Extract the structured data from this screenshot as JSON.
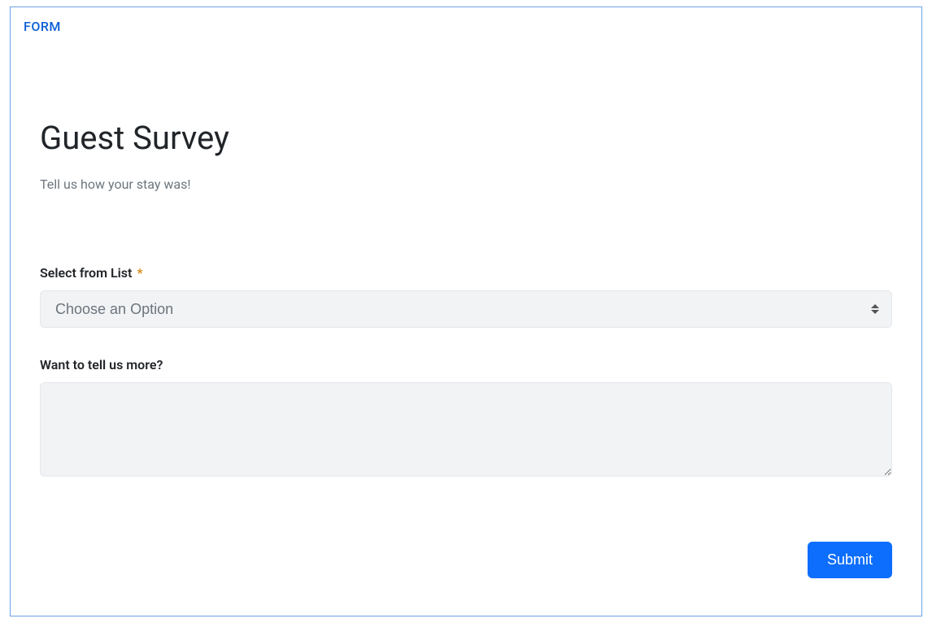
{
  "badge": "FORM",
  "title": "Guest Survey",
  "subtitle": "Tell us how your stay was!",
  "fields": {
    "select": {
      "label": "Select from List",
      "required_mark": "*",
      "placeholder": "Choose an Option"
    },
    "textarea": {
      "label": "Want to tell us more?",
      "value": ""
    }
  },
  "submit_label": "Submit"
}
